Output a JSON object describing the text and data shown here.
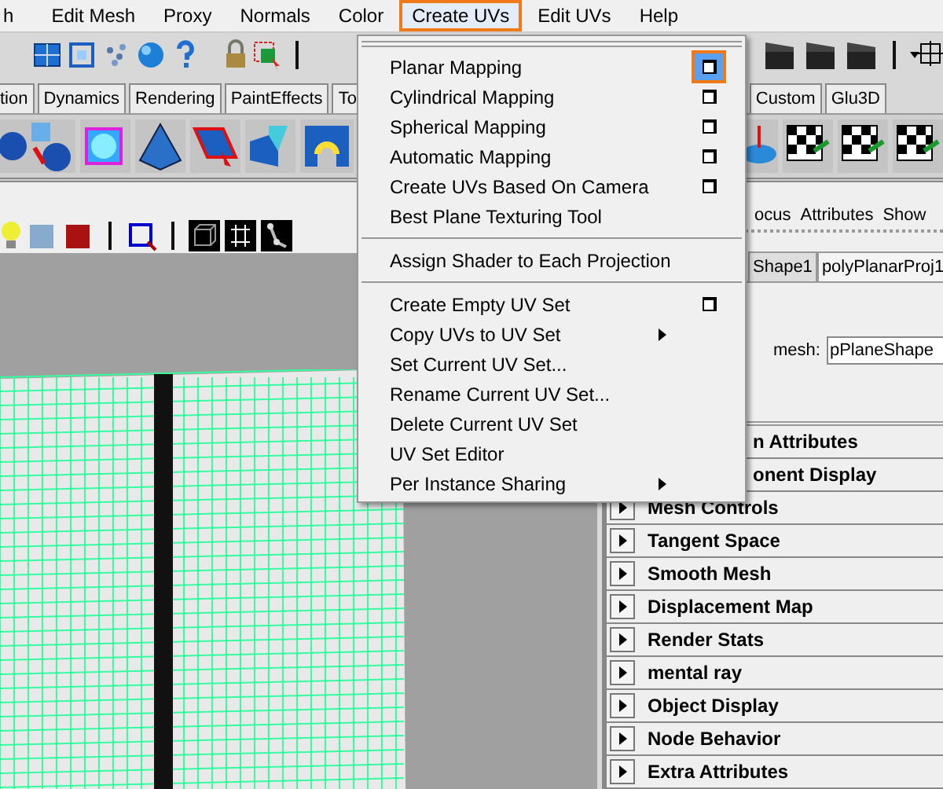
{
  "menubar": [
    {
      "label": "h",
      "selected": false
    },
    {
      "label": "Edit Mesh",
      "selected": false
    },
    {
      "label": "Proxy",
      "selected": false
    },
    {
      "label": "Normals",
      "selected": false
    },
    {
      "label": "Color",
      "selected": false
    },
    {
      "label": "Create UVs",
      "selected": true
    },
    {
      "label": "Edit UVs",
      "selected": false
    },
    {
      "label": "Help",
      "selected": false
    }
  ],
  "shelf_tabs_left": [
    "tion",
    "Dynamics",
    "Rendering",
    "PaintEffects",
    "To"
  ],
  "shelf_tabs_right": [
    "Custom",
    "Glu3D"
  ],
  "panel_menu": [
    "ocus",
    "Attributes",
    "Show"
  ],
  "attribute_tabs": [
    {
      "label": "Shape1",
      "selected": true
    },
    {
      "label": "polyPlanarProj1",
      "selected": false
    }
  ],
  "mesh_field": {
    "label": "mesh:",
    "value": "pPlaneShape"
  },
  "sections": [
    {
      "label": "n Attributes",
      "covered": true
    },
    {
      "label": "onent Display",
      "covered": true
    },
    {
      "label": "Mesh Controls",
      "covered": false
    },
    {
      "label": "Tangent Space",
      "covered": false
    },
    {
      "label": "Smooth Mesh",
      "covered": false
    },
    {
      "label": "Displacement Map",
      "covered": false
    },
    {
      "label": "Render Stats",
      "covered": false
    },
    {
      "label": "mental ray",
      "covered": false
    },
    {
      "label": "Object Display",
      "covered": false
    },
    {
      "label": "Node Behavior",
      "covered": false
    },
    {
      "label": "Extra Attributes",
      "covered": false
    }
  ],
  "dropdown": {
    "groups": [
      [
        {
          "label": "Planar Mapping",
          "option_box": true,
          "option_selected": true,
          "submenu": false
        },
        {
          "label": "Cylindrical Mapping",
          "option_box": true,
          "option_selected": false,
          "submenu": false
        },
        {
          "label": "Spherical Mapping",
          "option_box": true,
          "option_selected": false,
          "submenu": false
        },
        {
          "label": "Automatic Mapping",
          "option_box": true,
          "option_selected": false,
          "submenu": false
        },
        {
          "label": "Create UVs Based On Camera",
          "option_box": true,
          "option_selected": false,
          "submenu": false
        },
        {
          "label": "Best Plane Texturing Tool",
          "option_box": false,
          "submenu": false
        }
      ],
      [
        {
          "label": "Assign Shader to Each Projection",
          "option_box": false,
          "submenu": false
        }
      ],
      [
        {
          "label": "Create Empty UV Set",
          "option_box": true,
          "option_selected": false,
          "submenu": false
        },
        {
          "label": "Copy UVs to UV Set",
          "option_box": false,
          "submenu": true
        },
        {
          "label": "Set Current UV Set...",
          "option_box": false,
          "submenu": false
        },
        {
          "label": "Rename Current UV Set...",
          "option_box": false,
          "submenu": false
        },
        {
          "label": "Delete Current UV Set",
          "option_box": false,
          "submenu": false
        },
        {
          "label": "UV Set Editor",
          "option_box": false,
          "submenu": false
        },
        {
          "label": "Per Instance Sharing",
          "option_box": false,
          "submenu": true
        }
      ]
    ]
  }
}
